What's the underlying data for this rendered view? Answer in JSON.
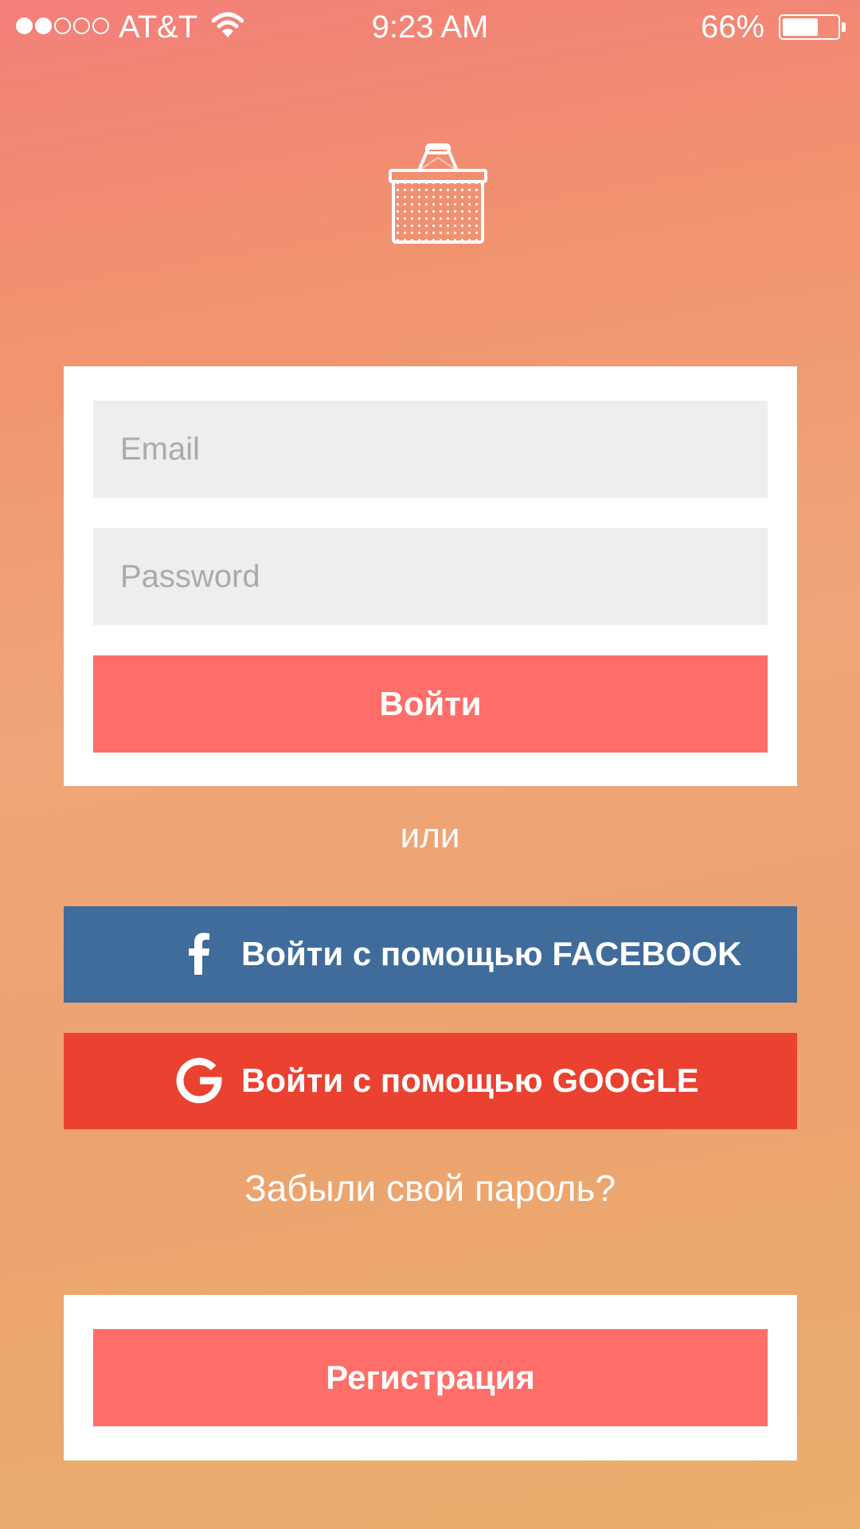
{
  "status_bar": {
    "signal_filled": 2,
    "signal_total": 5,
    "carrier": "AT&T",
    "time": "9:23 AM",
    "battery_percent": "66%",
    "battery_level": 0.66
  },
  "logo": {
    "icon": "shopping-basket-icon"
  },
  "login": {
    "email_placeholder": "Email",
    "password_placeholder": "Password",
    "submit_label": "Войти"
  },
  "divider_text": "или",
  "social": {
    "facebook_label": "Войти с помощью FACEBOOK",
    "facebook_color": "#3f6c9b",
    "google_label": "Войти с помощью GOOGLE",
    "google_color": "#eb4130"
  },
  "forgot_password": "Забыли свой пароль?",
  "register": {
    "label": "Регистрация"
  },
  "colors": {
    "accent": "#ff6e68",
    "gradient_top": "#f37f79",
    "gradient_bottom": "#eaae6d"
  }
}
